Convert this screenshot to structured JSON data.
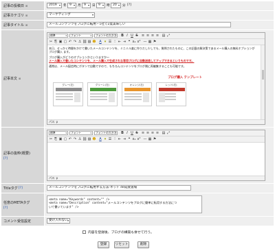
{
  "publish_date": {
    "label": "記事の投稿日",
    "year": "2019",
    "year_unit": "年",
    "month": "9",
    "month_unit": "月",
    "day": "9",
    "day_unit": "日",
    "hour": "9",
    "hour_unit": "時",
    "minute": "20",
    "minute_unit": "分",
    "help": "[?]"
  },
  "category": {
    "label": "記事カテゴリ",
    "value": "マーケティング"
  },
  "title": {
    "label": "記事タイトル",
    "value": "メールコンテンツをブログに転用・1社で2度美味しい"
  },
  "body": {
    "label": "記事本文",
    "toolbar": {
      "style": "標準",
      "font": "フォント",
      "size": "フォントの大きさ"
    },
    "path": "パス: p",
    "paragraphs": [
      "本日、せっかく時間をかけて書いたメールコンテンツを、ミニミル楽に作りだし少しでも、質問されたものに、この記載の解決策であるメール購入の無料オプションがブログ購入 ます。",
      "ブログ購入がどうのオプションかというますか〜",
      "メール購入で書いたコンテンツを、メール購入で生成されな専用ブログに自動送信してアップできるというものです。",
      "通常は、メール配信時にボタンで自動ですので、もちろんコンテンツをブログ側に再編集することも可能です。"
    ],
    "template_heading": "ブログ購入 テンプレート",
    "templates": [
      {
        "caption": "グレー(左)",
        "color": "#8d8d8d"
      },
      {
        "caption": "グリーン(左)",
        "color": "#4d9a3c"
      },
      {
        "caption": "オレンジ(左)",
        "color": "#e8942c"
      },
      {
        "caption": "レッド(右)",
        "color": "#c0392b"
      }
    ]
  },
  "summary": {
    "label": "記事の抜粋(概要)",
    "help": "[?]",
    "path": "パス: p"
  },
  "title_tag": {
    "label": "Titleタグ",
    "help": "[?]",
    "value": "メールコンテンツをブログに転用する方法-ネット de成受道場"
  },
  "meta": {
    "label": "任意のMETAタグ",
    "help": "[?]",
    "line1": "<meta name=\"Keywords\" content=\"\" />",
    "line2": "<meta name=\"Description\" content=\"メールコンテンツをブログに簡単に転用する方法につ",
    "line3": "いて書いています\" />"
  },
  "comments": {
    "label": "コメント受信設定",
    "value": "受け入れない"
  },
  "notify": {
    "label": "内容を登録後、ブログの構築も併せて行う。"
  },
  "buttons": {
    "save": "登録",
    "reset": "リセット",
    "delete": "削除"
  },
  "toolbar_icons": [
    "bold-icon",
    "italic-icon",
    "underline-icon",
    "strike-icon",
    "font-color-icon",
    "bg-color-icon",
    "list-icon",
    "numbered-list-icon",
    "outdent-icon",
    "indent-icon",
    "undo-icon",
    "redo-icon",
    "hr-icon",
    "image-icon",
    "table-icon"
  ],
  "colors": {
    "label_bg": "#d7d7d7",
    "field_bg": "#efefef",
    "help_link": "#1d4fb0",
    "accent_red": "#d21f1f",
    "accent_orange": "#e8942c"
  }
}
